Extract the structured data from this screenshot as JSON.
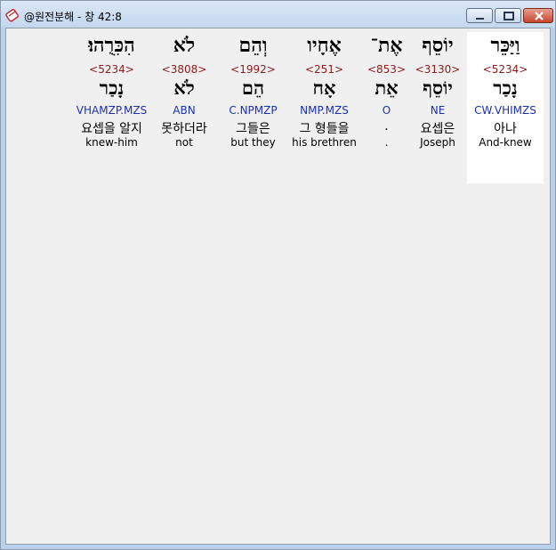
{
  "window": {
    "title": "@원전분해 - 창 42:8"
  },
  "verse": {
    "words": [
      {
        "hebrew": "וַיַּכֵּר",
        "strong": "<5234>",
        "lemma": "נָכַר",
        "morph": "CW.VHIMZS",
        "korean": "아나",
        "english": "And-knew",
        "highlighted": true
      },
      {
        "hebrew": "יוֹסֵף",
        "strong": "<3130>",
        "lemma": "יוֹסֵף",
        "morph": "NE",
        "korean": "요셉은",
        "english": "Joseph",
        "highlighted": false
      },
      {
        "hebrew": "אֶת־",
        "strong": "<853>",
        "lemma": "אֵת",
        "morph": "O",
        "korean": ".",
        "english": ".",
        "highlighted": false
      },
      {
        "hebrew": "אֶחָיו",
        "strong": "<251>",
        "lemma": "אָח",
        "morph": "NMP.MZS",
        "korean": "그 형들을",
        "english": "his brethren",
        "highlighted": false
      },
      {
        "hebrew": "וְהֵם",
        "strong": "<1992>",
        "lemma": "הֵם",
        "morph": "C.NPMZP",
        "korean": "그들은",
        "english": "but they",
        "highlighted": false
      },
      {
        "hebrew": "לֹא",
        "strong": "<3808>",
        "lemma": "לֹא",
        "morph": "ABN",
        "korean": "못하더라",
        "english": "not",
        "highlighted": false
      },
      {
        "hebrew": "הִכִּרֻהוּ׃",
        "strong": "<5234>",
        "lemma": "נָכַר",
        "morph": "VHAMZP.MZS",
        "korean": "요셉을 알지",
        "english": "knew-him",
        "highlighted": false
      }
    ]
  },
  "colors": {
    "strong": "#8b1a1a",
    "morph": "#1c2fb0",
    "highlight": "#ffffff",
    "background": "#f0f0f0"
  }
}
